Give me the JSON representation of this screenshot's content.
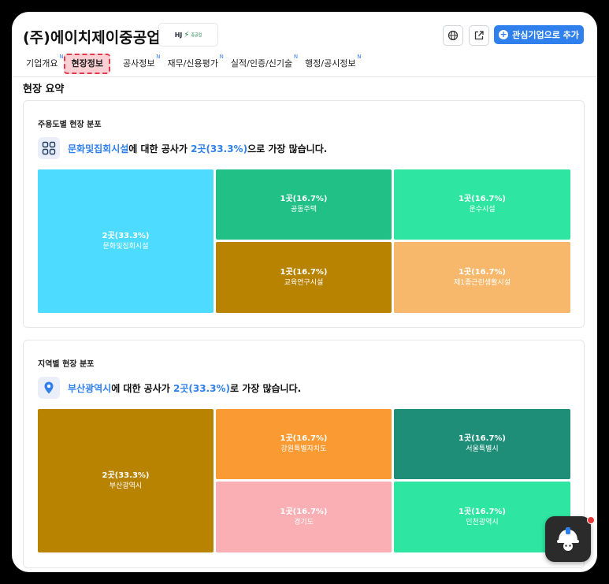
{
  "header": {
    "company_name": "(주)에이치제이중공업",
    "logo_text": "HJ",
    "logo_sub": "중공업",
    "add_button_label": "관심기업으로 추가"
  },
  "tabs": [
    {
      "label": "기업개요",
      "badge": "N"
    },
    {
      "label": "현장정보",
      "badge": ""
    },
    {
      "label": "공사정보",
      "badge": "N"
    },
    {
      "label": "재무/신용평가",
      "badge": "N"
    },
    {
      "label": "실적/인증/신기술",
      "badge": "N"
    },
    {
      "label": "행정/공시정보",
      "badge": "N"
    }
  ],
  "section_title": "현장 요약",
  "usage_card": {
    "title": "주용도별 현장 분포",
    "highlight": "문화및집회시설",
    "middle_text": "에 대한 공사가 ",
    "highlight_count": "2곳(33.3%)",
    "suffix_text": "으로 가장 많습니다.",
    "tiles": [
      {
        "count": "2곳(33.3%)",
        "label": "문화및집회시설",
        "color": "#4ddcff"
      },
      {
        "count": "1곳(16.7%)",
        "label": "공동주택",
        "color": "#20c086"
      },
      {
        "count": "1곳(16.7%)",
        "label": "운수시설",
        "color": "#2ee6a2"
      },
      {
        "count": "1곳(16.7%)",
        "label": "교육연구시설",
        "color": "#b88300"
      },
      {
        "count": "1곳(16.7%)",
        "label": "제1종근린생활시설",
        "color": "#f8b86b"
      }
    ]
  },
  "region_card": {
    "title": "지역별 현장 분포",
    "highlight": "부산광역시",
    "middle_text": "에 대한 공사가 ",
    "highlight_count": "2곳(33.3%)",
    "suffix_text": "로 가장 많습니다.",
    "tiles": [
      {
        "count": "2곳(33.3%)",
        "label": "부산광역시",
        "color": "#b88300"
      },
      {
        "count": "1곳(16.7%)",
        "label": "강원특별자치도",
        "color": "#f99a32"
      },
      {
        "count": "1곳(16.7%)",
        "label": "서울특별시",
        "color": "#1e8e78"
      },
      {
        "count": "1곳(16.7%)",
        "label": "경기도",
        "color": "#f9afb4"
      },
      {
        "count": "1곳(16.7%)",
        "label": "인천광역시",
        "color": "#2ee6a2"
      }
    ]
  },
  "icons": {
    "globe": "globe-icon",
    "share": "external-link-icon",
    "plus": "plus-circle-icon",
    "grid": "grid-icon",
    "location": "location-pin-icon",
    "helmet": "helmet-icon"
  }
}
